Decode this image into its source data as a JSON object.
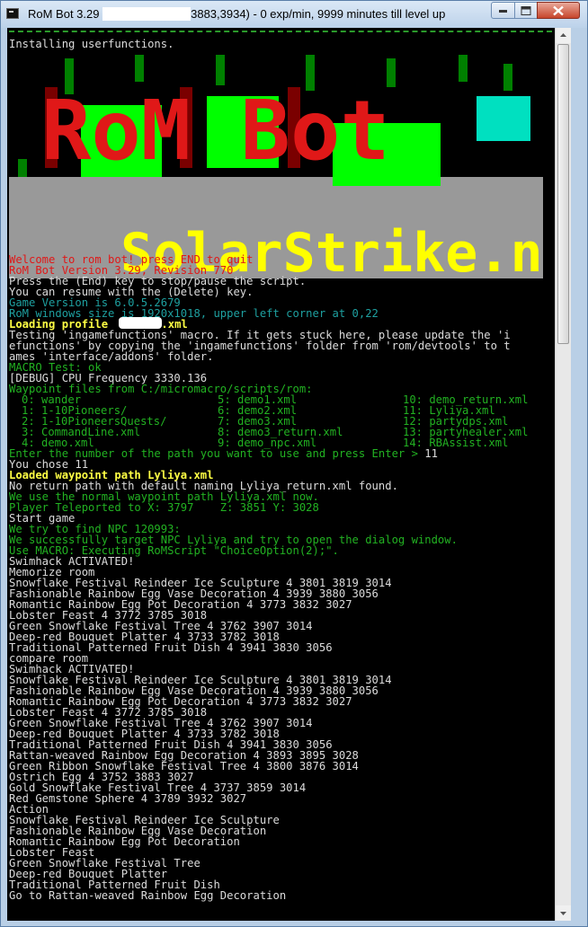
{
  "window": {
    "title_prefix": "RoM Bot 3.29 ",
    "title_suffix": "3883,3934) - 0 exp/min, 9999 minutes till level up"
  },
  "logo": {
    "text1": "RoM Bot",
    "text2": "SolarStrike.net"
  },
  "console": {
    "line_installing": "Installing userfunctions.",
    "welcome": "Welcome to rom bot! press END to quit",
    "version": "RoM Bot Version 3.29, Revision 770",
    "press_end": "Press the (End) key to stop/pause the script.",
    "resume": "You can resume with the (Delete) key.",
    "game_version": "Game Version is 6.0.5.2679",
    "window_size": "RoM windows size is 1920x1018, upper left corner at 0,22",
    "loading_profile": "Loading profile ",
    "loading_profile_ext": ".xml",
    "testing1": "Testing 'ingamefunctions' macro. If it gets stuck here, please update the 'i",
    "testing2": "efunctions' by copying the 'ingamefunctions' folder from 'rom/devtools' to t",
    "testing3": "ames 'interface/addons' folder.",
    "macro_test": "MACRO Test: ok",
    "debug_cpu": "[DEBUG] CPU Frequency 3330.136",
    "waypoint_header": "Waypoint files from C:/micromacro/scripts/rom:",
    "enter_number": "Enter the number of the path you want to use and press Enter > ",
    "entered_value": "11",
    "you_chose": "You chose 11",
    "loaded_waypoint": "Loaded waypoint path Lyliya.xml",
    "no_return": "No return path with default naming Lyliya_return.xml found.",
    "normal_waypoint": "We use the normal waypoint path Lyliya.xml now.",
    "teleported": "Player Teleported to X: 3797    Z: 3851 Y: 3028",
    "start_game": "Start game",
    "find_npc": "We try to find NPC 120993:",
    "target_npc": "We successfully target NPC Lyliya and try to open the dialog window.",
    "use_macro": "Use MACRO: Executing RoMScript \"ChoiceOption(2);\".",
    "swimhack1": "Swimhack ACTIVATED!",
    "memorize": "Memorize room",
    "compare": "compare room",
    "swimhack2": "Swimhack ACTIVATED!",
    "action": "Action",
    "go_to": "Go to Rattan-weaved Rainbow Egg Decoration"
  },
  "waypoints": [
    "0: wander",
    "1: 1-10Pioneers/",
    "2: 1-10PioneersQuests/",
    "3: CommandLine.xml",
    "4: demo.xml",
    "5: demo1.xml",
    "6: demo2.xml",
    "7: demo3.xml",
    "8: demo3_return.xml",
    "9: demo_npc.xml",
    "10: demo_return.xml",
    "11: Lyliya.xml",
    "12: partydps.xml",
    "13: partyhealer.xml",
    "14: RBAssist.xml"
  ],
  "memorize_items": [
    "Snowflake Festival Reindeer Ice Sculpture 4 3801 3819 3014",
    "Fashionable Rainbow Egg Vase Decoration 4 3939 3880 3056",
    "Romantic Rainbow Egg Pot Decoration 4 3773 3832 3027",
    "Lobster Feast 4 3772 3785 3018",
    "Green Snowflake Festival Tree 4 3762 3907 3014",
    "Deep-red Bouquet Platter 4 3733 3782 3018",
    "Traditional Patterned Fruit Dish 4 3941 3830 3056"
  ],
  "compare_items": [
    "Snowflake Festival Reindeer Ice Sculpture 4 3801 3819 3014",
    "Fashionable Rainbow Egg Vase Decoration 4 3939 3880 3056",
    "Romantic Rainbow Egg Pot Decoration 4 3773 3832 3027",
    "Lobster Feast 4 3772 3785 3018",
    "Green Snowflake Festival Tree 4 3762 3907 3014",
    "Deep-red Bouquet Platter 4 3733 3782 3018",
    "Traditional Patterned Fruit Dish 4 3941 3830 3056",
    "Rattan-weaved Rainbow Egg Decoration 4 3893 3895 3028",
    "Green Ribbon Snowflake Festival Tree 4 3800 3876 3014",
    "Ostrich Egg 4 3752 3883 3027",
    "Gold Snowflake Festival Tree 4 3737 3859 3014",
    "Red Gemstone Sphere 4 3789 3932 3027"
  ],
  "action_items": [
    "Snowflake Festival Reindeer Ice Sculpture",
    "Fashionable Rainbow Egg Vase Decoration",
    "Romantic Rainbow Egg Pot Decoration",
    "Lobster Feast",
    "Green Snowflake Festival Tree",
    "Deep-red Bouquet Platter",
    "Traditional Patterned Fruit Dish"
  ],
  "colors": {
    "console_bg": "#000000",
    "text_white": "#dcdcdc",
    "text_red": "#e01818",
    "text_yellow": "#ffff44",
    "text_green": "#22b222",
    "text_cyan": "#1ea0a0"
  }
}
